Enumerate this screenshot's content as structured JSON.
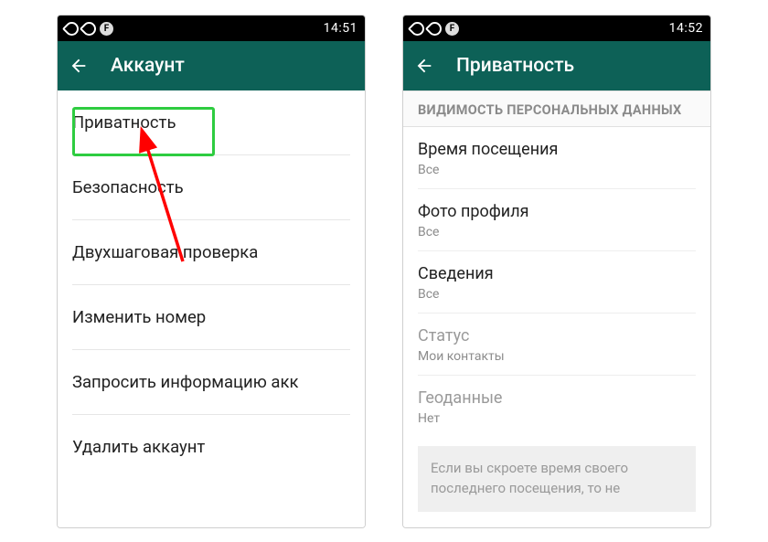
{
  "colors": {
    "header_bg": "#0d6157",
    "highlight": "#2ecc40",
    "arrow": "#ff0000"
  },
  "left": {
    "status": {
      "time": "14:51"
    },
    "header": {
      "title": "Аккаунт"
    },
    "items": [
      {
        "label": "Приватность"
      },
      {
        "label": "Безопасность"
      },
      {
        "label": "Двухшаговая проверка"
      },
      {
        "label": "Изменить номер"
      },
      {
        "label": "Запросить информацию акк"
      },
      {
        "label": "Удалить аккаунт"
      }
    ]
  },
  "right": {
    "status": {
      "time": "14:52"
    },
    "header": {
      "title": "Приватность"
    },
    "section_header": "ВИДИМОСТЬ ПЕРСОНАЛЬНЫХ ДАННЫХ",
    "items": [
      {
        "title": "Время посещения",
        "sub": "Все"
      },
      {
        "title": "Фото профиля",
        "sub": "Все"
      },
      {
        "title": "Сведения",
        "sub": "Все"
      },
      {
        "title": "Статус",
        "sub": "Мои контакты",
        "disabled": true
      },
      {
        "title": "Геоданные",
        "sub": "Нет",
        "disabled": true
      }
    ],
    "info_text": "Если вы скроете время своего последнего посещения, то не"
  }
}
